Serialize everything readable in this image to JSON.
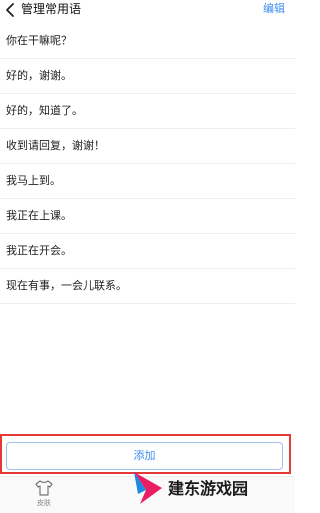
{
  "header": {
    "back_icon": "chevron-left-icon",
    "title": "管理常用语",
    "edit_label": "编辑"
  },
  "phrases": [
    {
      "text": "你在干嘛呢？"
    },
    {
      "text": "好的，谢谢。"
    },
    {
      "text": "好的，知道了。"
    },
    {
      "text": "收到请回复，谢谢！"
    },
    {
      "text": "我马上到。"
    },
    {
      "text": "我正在上课。"
    },
    {
      "text": "我正在开会。"
    },
    {
      "text": "现在有事，一会儿联系。"
    }
  ],
  "footer": {
    "add_label": "添加",
    "highlight_color": "#e53935"
  },
  "bottom_nav": {
    "items": [
      {
        "icon": "shirt-icon",
        "label": "皮肤"
      }
    ]
  },
  "watermark": {
    "text": "建东游戏园",
    "logo_colors": [
      "#e91e63",
      "#1e88e5"
    ]
  },
  "colors": {
    "accent": "#3f8cf0",
    "text": "#222222",
    "divider": "#eeeeee"
  }
}
